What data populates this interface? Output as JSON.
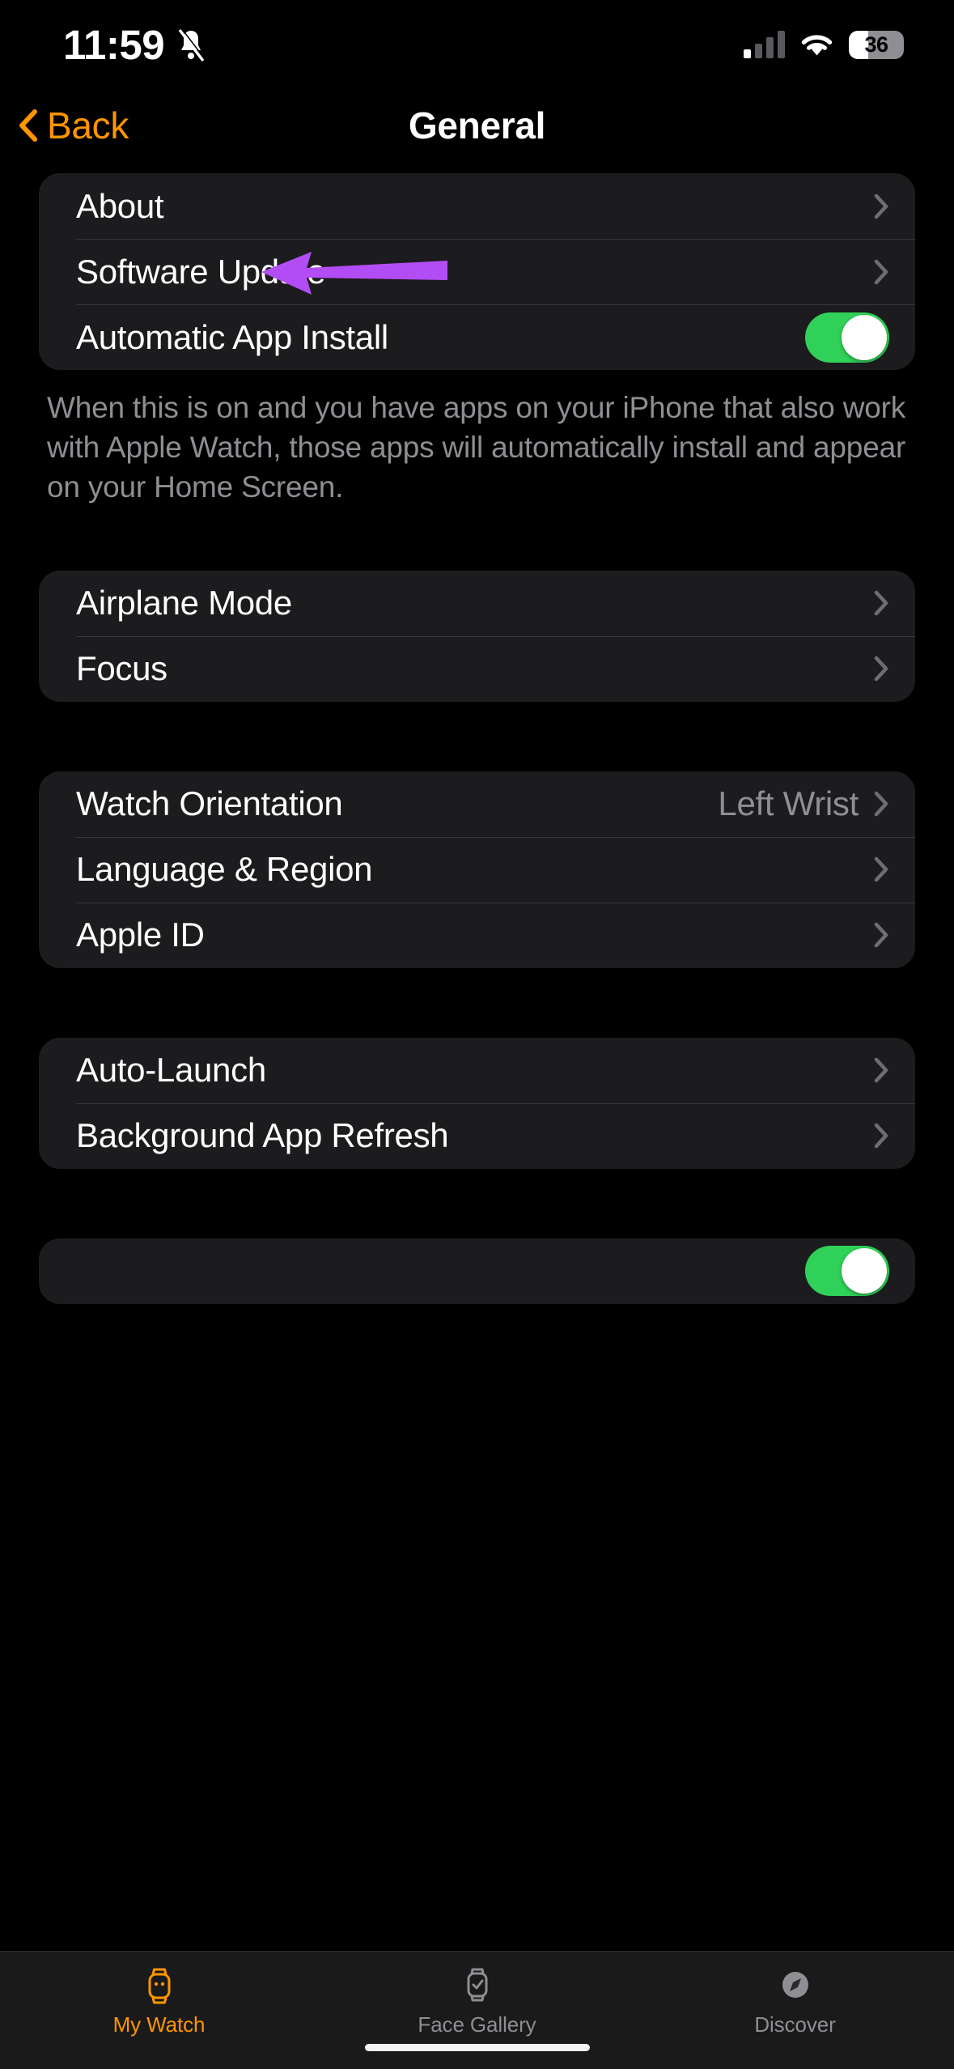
{
  "status_bar": {
    "time": "11:59",
    "mute_icon": "bell-slash-icon",
    "signal_icon": "cellular-signal-icon",
    "wifi_icon": "wifi-icon",
    "battery_percent": "36"
  },
  "nav": {
    "back_label": "Back",
    "back_icon": "chevron-left-icon",
    "title": "General"
  },
  "groups": [
    {
      "rows": [
        {
          "label": "About",
          "type": "disclosure",
          "value": ""
        },
        {
          "label": "Software Update",
          "type": "disclosure",
          "value": ""
        },
        {
          "label": "Automatic App Install",
          "type": "toggle",
          "value": "on"
        }
      ],
      "footer": "When this is on and you have apps on your iPhone that also work with Apple Watch, those apps will automatically install and appear on your Home Screen."
    },
    {
      "rows": [
        {
          "label": "Airplane Mode",
          "type": "disclosure",
          "value": ""
        },
        {
          "label": "Focus",
          "type": "disclosure",
          "value": ""
        }
      ],
      "footer": ""
    },
    {
      "rows": [
        {
          "label": "Watch Orientation",
          "type": "disclosure",
          "value": "Left Wrist"
        },
        {
          "label": "Language & Region",
          "type": "disclosure",
          "value": ""
        },
        {
          "label": "Apple ID",
          "type": "disclosure",
          "value": ""
        }
      ],
      "footer": ""
    },
    {
      "rows": [
        {
          "label": "Auto-Launch",
          "type": "disclosure",
          "value": ""
        },
        {
          "label": "Background App Refresh",
          "type": "disclosure",
          "value": ""
        }
      ],
      "footer": ""
    },
    {
      "rows": [
        {
          "label": "",
          "type": "toggle",
          "value": "on"
        }
      ],
      "footer": ""
    }
  ],
  "annotation": {
    "shape": "left-pointing-arrow",
    "color": "#b24df5",
    "points_at": "Software Update"
  },
  "tabs": [
    {
      "label": "My Watch",
      "icon": "watch-icon",
      "active": true
    },
    {
      "label": "Face Gallery",
      "icon": "watch-face-icon",
      "active": false
    },
    {
      "label": "Discover",
      "icon": "compass-icon",
      "active": false
    }
  ],
  "colors": {
    "accent": "#FF9500",
    "toggle_on": "#30D158",
    "card": "#1c1c1e",
    "secondary_text": "#8e8e93",
    "annotation": "#b24df5"
  }
}
